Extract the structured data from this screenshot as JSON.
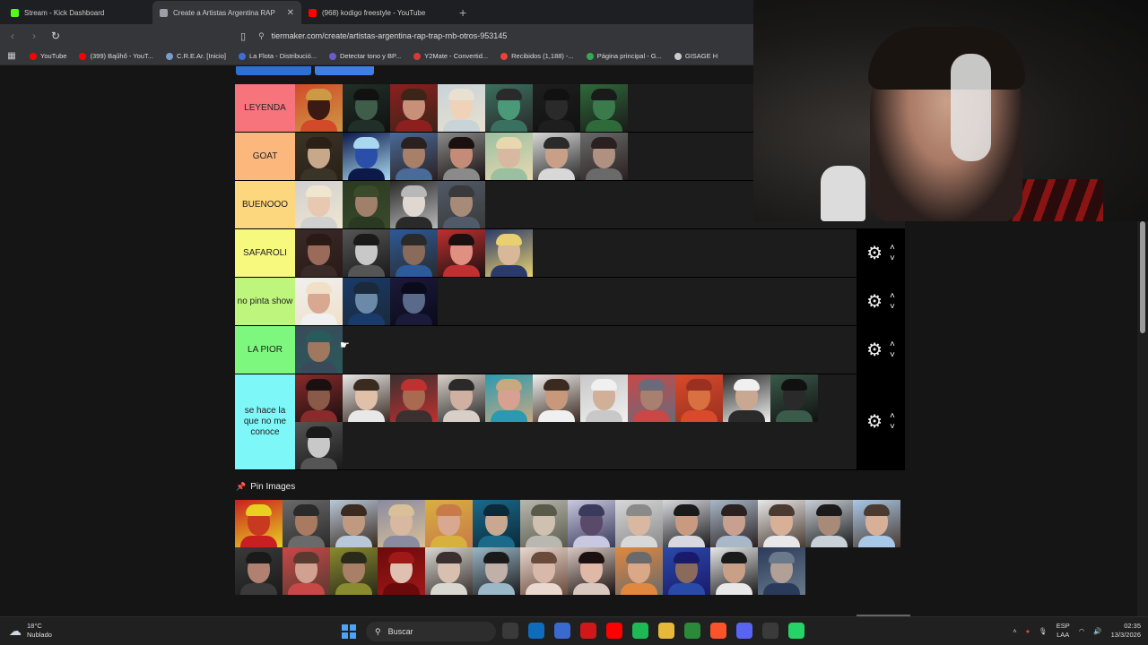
{
  "browser": {
    "tabs": [
      {
        "title": "Stream - Kick Dashboard",
        "icon_color": "#53fc18",
        "active": false
      },
      {
        "title": "Create a Artistas Argentina RAP",
        "icon_color": "#9aa0a6",
        "active": true
      },
      {
        "title": "(968) kodigo freestyle - YouTube",
        "icon_color": "#ff0000",
        "active": false
      }
    ],
    "new_tab": "+",
    "url": "tiermaker.com/create/artistas-argentina-rap-trap-rnb-otros-953145",
    "bookmarks": [
      {
        "label": "YouTube",
        "color": "#ff0000"
      },
      {
        "label": "(399) Bąűhő - YouT...",
        "color": "#ff0000"
      },
      {
        "label": "C.R.E.Ar. [Inicio]",
        "color": "#7a9cc6"
      },
      {
        "label": "La Flota - Distribució...",
        "color": "#3b6fd6"
      },
      {
        "label": "Detectar tono y BP...",
        "color": "#6a5acd"
      },
      {
        "label": "Y2Mate - Convertid...",
        "color": "#d63b3b"
      },
      {
        "label": "Recibidos (1,188) -...",
        "color": "#ea4335"
      },
      {
        "label": "Página principal - G...",
        "color": "#34a853"
      },
      {
        "label": "GISAGE H",
        "color": "#cccccc"
      }
    ]
  },
  "tiers": [
    {
      "label": "LEYENDA",
      "color": "#f8747c",
      "controls": false,
      "items": [
        [
          "#3a1a12",
          "#c94",
          "#d34a2a"
        ],
        [
          "#3f5e4a",
          "#111",
          "#203028"
        ],
        [
          "#c89078",
          "#3b2418",
          "#8d1f1f"
        ],
        [
          "#f0d2b8",
          "#e8e0d0",
          "#c8d4d8"
        ],
        [
          "#4a9a7a",
          "#2a2a2a",
          "#3a7060"
        ],
        [
          "#2a2a2a",
          "#111",
          "#1e1e1e"
        ],
        [
          "#3b7a4a",
          "#1a1a1a",
          "#2f6a3a"
        ]
      ]
    },
    {
      "label": "GOAT",
      "color": "#fbb77c",
      "controls": false,
      "items": [
        [
          "#c8a88a",
          "#2a2016",
          "#3a3426"
        ],
        [
          "#2a4fa8",
          "#a8d8f0",
          "#0c1a4a"
        ],
        [
          "#a87f68",
          "#2a2020",
          "#4a6a9a"
        ],
        [
          "#c48c78",
          "#1a1010",
          "#8a8a8a"
        ],
        [
          "#d8b8a0",
          "#e8d8b0",
          "#9ac0a0"
        ],
        [
          "#c8a088",
          "#2a2a2a",
          "#d8d8d8"
        ],
        [
          "#b09080",
          "#2a2020",
          "#6a6a6a"
        ]
      ]
    },
    {
      "label": "BUENOOO",
      "color": "#fcd77d",
      "controls": false,
      "items": [
        [
          "#e8c8b0",
          "#f0e6d0",
          "#d0d0d0"
        ],
        [
          "#a0806a",
          "#3a4a2a",
          "#2a3a22"
        ],
        [
          "#e0d8d0",
          "#b8b8b8",
          "#2a2a2a"
        ],
        [
          "#a88a78",
          "#3a3a3a",
          "#505a68"
        ]
      ]
    },
    {
      "label": "SAFAROLI",
      "color": "#f7f87e",
      "controls": true,
      "items": [
        [
          "#9a6a5a",
          "#2a1a16",
          "#3a2a28"
        ],
        [
          "#c8c8c8",
          "#1a1a1a",
          "#555"
        ],
        [
          "#8a6a5a",
          "#2a2a2a",
          "#2c5a9a"
        ],
        [
          "#e09080",
          "#1a1010",
          "#c03030"
        ],
        [
          "#d8b898",
          "#e8d070",
          "#2a3a6a"
        ]
      ]
    },
    {
      "label": "no pinta show",
      "color": "#bef67d",
      "controls": true,
      "items": [
        [
          "#d8a890",
          "#f0e0c8",
          "#f0f0f0"
        ],
        [
          "#6a8aa8",
          "#1a2a3a",
          "#1a3a6a"
        ],
        [
          "#5a6a8a",
          "#0a0a1a",
          "#1a1a3a"
        ]
      ]
    },
    {
      "label": "LA PIOR",
      "color": "#7ef77f",
      "controls": true,
      "items": [
        [
          "#a07860",
          "#2a5a5a",
          "#3a4a5a"
        ]
      ]
    },
    {
      "label": "se hace la que no me conoce",
      "color": "#7ef7f9",
      "controls": true,
      "items": [
        [
          "#8a5a48",
          "#1a1010",
          "#8a2a2a"
        ],
        [
          "#e0c0a8",
          "#3a2a20",
          "#e8e8e8"
        ],
        [
          "#a86a50",
          "#c03030",
          "#3a3030"
        ],
        [
          "#d0b0a0",
          "#2a2a2a",
          "#d8d0c8"
        ],
        [
          "#d8a090",
          "#c8a880",
          "#2a9ab0"
        ],
        [
          "#c8987a",
          "#3a2a20",
          "#f0f0f0"
        ],
        [
          "#d0b098",
          "#f0f0f0",
          "#c8c8c8"
        ],
        [
          "#a88070",
          "#6a6a7a",
          "#c84848"
        ],
        [
          "#d87040",
          "#9a3020",
          "#d84a2a"
        ],
        [
          "#c8a890",
          "#f0f0f0",
          "#2a2a2a"
        ],
        [
          "#2a2a2a",
          "#111",
          "#3a5a4a"
        ],
        [
          "#c8c8c8",
          "#1a1a1a",
          "#555"
        ]
      ]
    }
  ],
  "pin_images": {
    "title": "Pin Images",
    "items": [
      [
        "#c83a20",
        "#e8d020",
        "#c82020"
      ],
      [
        "#a87a60",
        "#2a2a2a",
        "#6a6a6a"
      ],
      [
        "#c09a80",
        "#3a2a20",
        "#b8c8d8"
      ],
      [
        "#d8b8a0",
        "#d8c098",
        "#8a8aa0"
      ],
      [
        "#d8a890",
        "#c87a48",
        "#d8b040"
      ],
      [
        "#c8a890",
        "#0a2a3a",
        "#1a6a8a"
      ],
      [
        "#d0c0b0",
        "#5a5a4a",
        "#b8b8b0"
      ],
      [
        "#5a4a6a",
        "#3a3a5a",
        "#c8c8e0"
      ],
      [
        "#d8b8a0",
        "#8a8a8a",
        "#d8d8d8"
      ],
      [
        "#c89a80",
        "#1a1a1a",
        "#d8d8e0"
      ],
      [
        "#c8a090",
        "#2a2020",
        "#a8b8c8"
      ],
      [
        "#d8b098",
        "#4a3a30",
        "#e8e8e8"
      ],
      [
        "#a88a78",
        "#1a1a1a",
        "#c8d0d8"
      ],
      [
        "#d8b098",
        "#4a3a30",
        "#a8c8e8"
      ],
      [
        "#b08070",
        "#1a1a1a",
        "#3a3a3a"
      ],
      [
        "#d0a090",
        "#5a3a30",
        "#c84848"
      ],
      [
        "#a88068",
        "#2a2a1a",
        "#8a8a30"
      ],
      [
        "#e0c0b0",
        "#a01818",
        "#6a0a0a"
      ],
      [
        "#d8c0b0",
        "#3a3030",
        "#d8d8d0"
      ],
      [
        "#c0b0a8",
        "#1a1a1a",
        "#9ab8c8"
      ],
      [
        "#d8b8a8",
        "#6a4a3a",
        "#e8d8d0"
      ],
      [
        "#e0b8a8",
        "#1a1010",
        "#d8c8c0"
      ],
      [
        "#d8a888",
        "#6a6a6a",
        "#e08840"
      ],
      [
        "#8a6a5a",
        "#1a1a6a",
        "#2a4aa8"
      ],
      [
        "#c8a088",
        "#1a1a1a",
        "#e8e8e8"
      ],
      [
        "#b0a098",
        "#6a7a8a",
        "#2a3a5a"
      ]
    ]
  },
  "taskbar": {
    "weather_temp": "18°C",
    "weather_desc": "Nublado",
    "search_placeholder": "Buscar",
    "lang_top": "ESP",
    "lang_bottom": "LAA",
    "time": "02:35",
    "date": "13/3/2026",
    "apps": [
      {
        "name": "file-explorer-icon",
        "color": "#3a3a3a"
      },
      {
        "name": "outlook-icon",
        "color": "#0f6cbd"
      },
      {
        "name": "camera-app-icon",
        "color": "#3a6ad0"
      },
      {
        "name": "roblox-icon",
        "color": "#d01818"
      },
      {
        "name": "youtube-icon",
        "color": "#ff0000"
      },
      {
        "name": "spotify-icon",
        "color": "#1db954"
      },
      {
        "name": "folder-icon",
        "color": "#e8b83a"
      },
      {
        "name": "bittorrent-icon",
        "color": "#2a8a3a"
      },
      {
        "name": "brave-icon",
        "color": "#fb542b"
      },
      {
        "name": "discord-icon",
        "color": "#5865f2"
      },
      {
        "name": "obs-icon",
        "color": "#3a3a3a"
      },
      {
        "name": "whatsapp-icon",
        "color": "#25d366"
      }
    ]
  }
}
